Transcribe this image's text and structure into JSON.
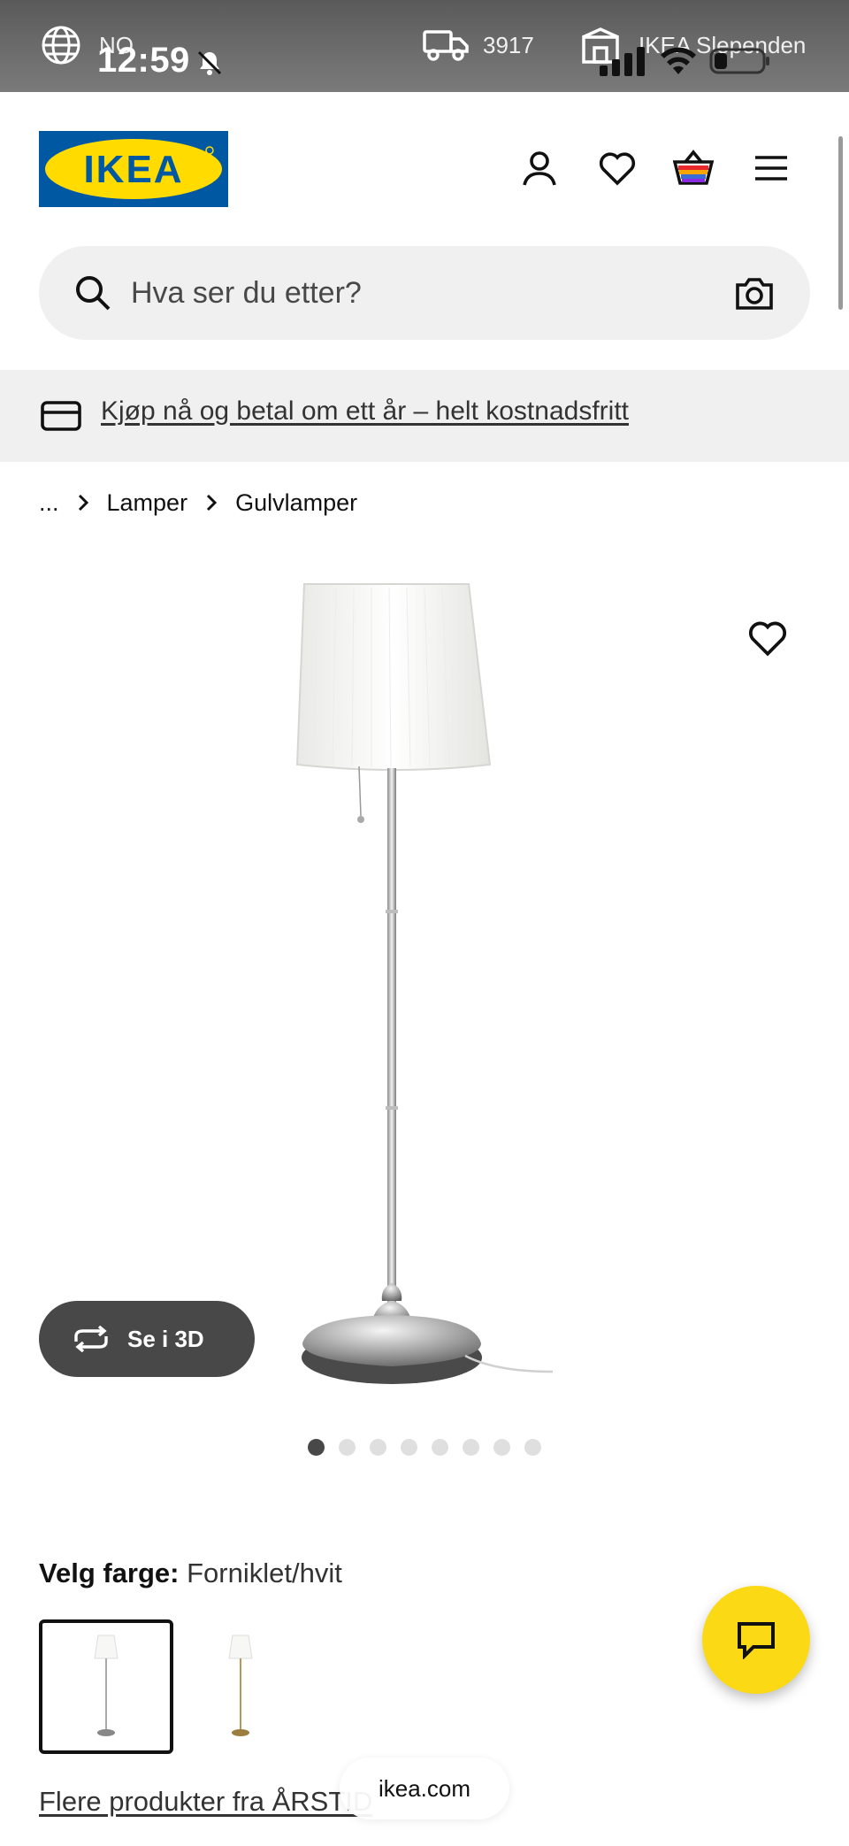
{
  "status_bar": {
    "language": "NO",
    "time": "12:59",
    "postcode": "3917",
    "store_name": "IKEA Slependen"
  },
  "header": {
    "logo_text": "IKEA",
    "brand_colors": {
      "blue": "#0058a3",
      "yellow": "#ffdb00"
    },
    "icons": [
      "account-icon",
      "heart-icon",
      "cart-icon",
      "menu-icon"
    ]
  },
  "search": {
    "placeholder": "Hva ser du etter?"
  },
  "promo": {
    "text": "Kjøp nå og betal om ett år – helt kostnadsfritt"
  },
  "breadcrumb": {
    "items": [
      "...",
      "Lamper",
      "Gulvlamper"
    ]
  },
  "product": {
    "see_3d_label": "Se i 3D",
    "image_count": 8,
    "active_image": 1,
    "colour_label": "Velg farge:",
    "colour_value": "Forniklet/hvit",
    "swatches": [
      "Forniklet/hvit",
      "Messing/hvit"
    ],
    "selected_swatch": 0,
    "more_products_link": "Flere produkter fra ÅRSTID"
  },
  "browser": {
    "url": "ikea.com"
  },
  "chat": {
    "accent": "#fbd914"
  }
}
